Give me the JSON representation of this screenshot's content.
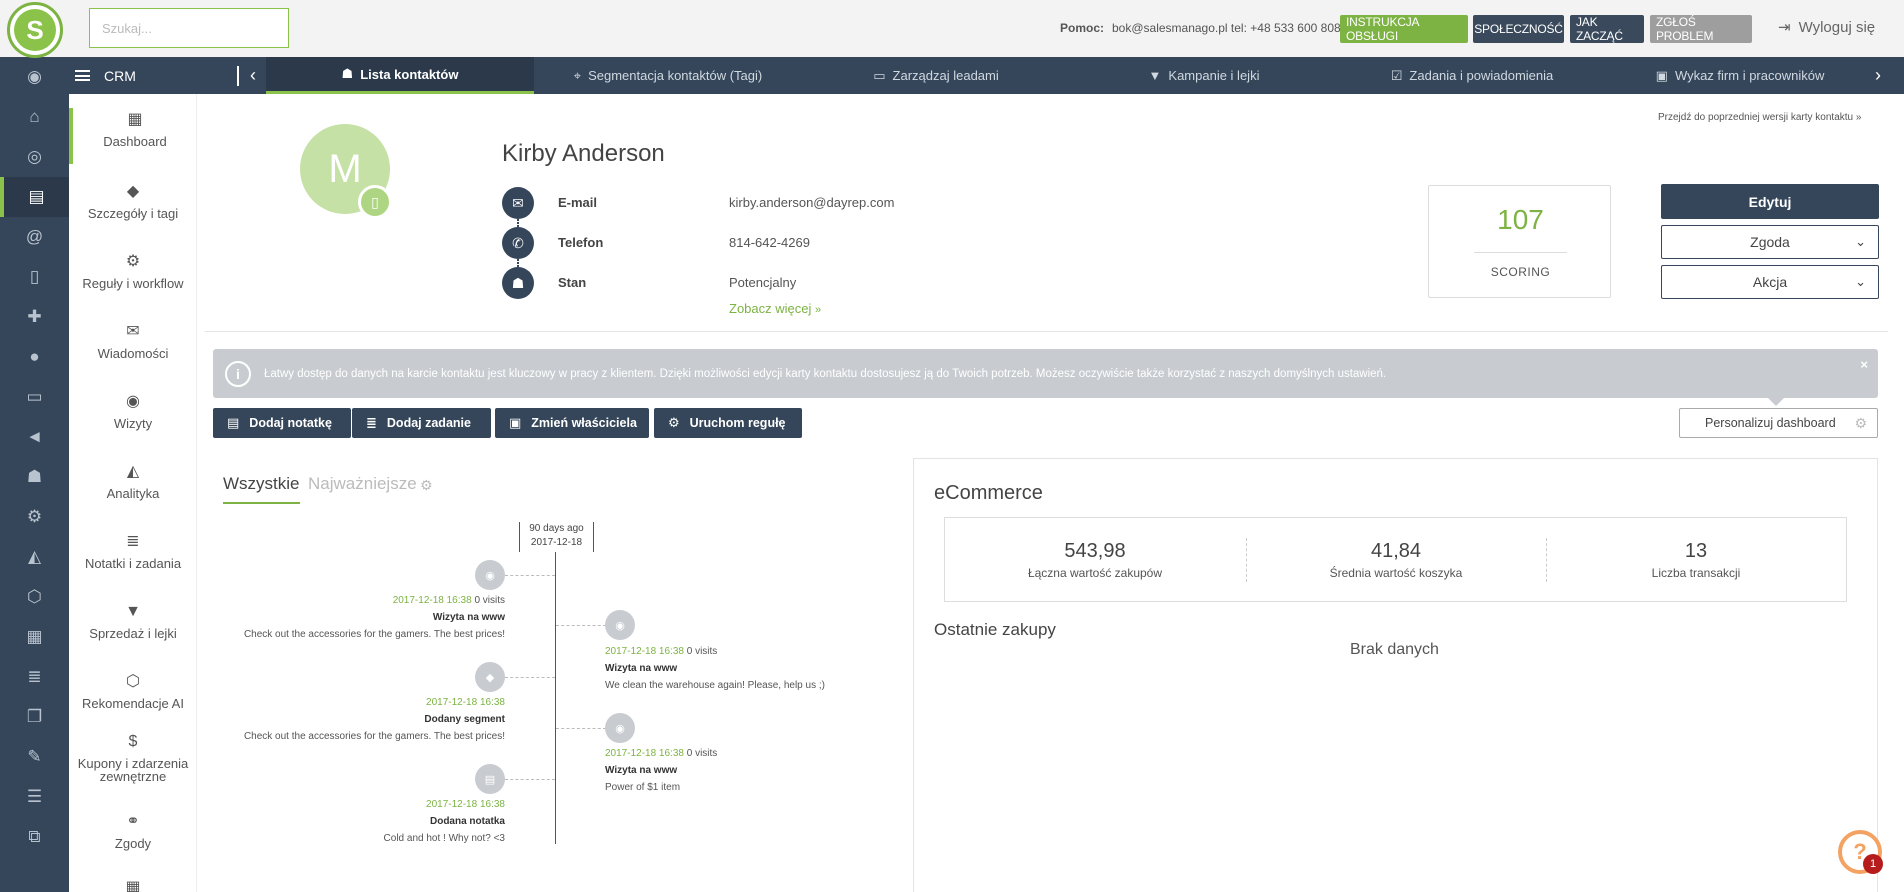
{
  "header": {
    "logo_letter": "S",
    "search_placeholder": "Szukaj...",
    "help_label": "Pomoc:",
    "help_contact": "bok@salesmanago.pl tel: +48 533 600 808",
    "btn_manual": "INSTRUKCJA OBSŁUGI",
    "btn_community": "SPOŁECZNOŚĆ",
    "btn_start": "JAK ZACZĄĆ",
    "btn_report": "ZGŁOŚ PROBLEM",
    "logout": "Wyloguj się"
  },
  "nav": {
    "crm": "CRM",
    "tabs": [
      {
        "label": "Lista kontaktów",
        "icon": "users-icon"
      },
      {
        "label": "Segmentacja kontaktów (Tagi)",
        "icon": "tags-icon"
      },
      {
        "label": "Zarządzaj leadami",
        "icon": "id-card-icon"
      },
      {
        "label": "Kampanie i lejki",
        "icon": "filter-icon"
      },
      {
        "label": "Zadania i powiadomienia",
        "icon": "check-square-icon"
      },
      {
        "label": "Wykaz firm i pracowników",
        "icon": "briefcase-icon"
      }
    ]
  },
  "sidebar": {
    "items": [
      {
        "label": "Dashboard",
        "icon": "grid-icon"
      },
      {
        "label": "Szczegóły i tagi",
        "icon": "tags-icon"
      },
      {
        "label": "Reguły i workflow",
        "icon": "cogs-icon"
      },
      {
        "label": "Wiadomości",
        "icon": "envelope-open-icon"
      },
      {
        "label": "Wizyty",
        "icon": "eye-icon"
      },
      {
        "label": "Analityka",
        "icon": "area-chart-icon"
      },
      {
        "label": "Notatki i zadania",
        "icon": "list-icon"
      },
      {
        "label": "Sprzedaż i lejki",
        "icon": "filter-icon"
      },
      {
        "label": "Rekomendacje AI",
        "icon": "ai-icon"
      },
      {
        "label": "Kupony i zdarzenia zewnętrzne",
        "icon": "dollar-icon"
      },
      {
        "label": "Zgody",
        "icon": "handshake-icon"
      }
    ]
  },
  "contact": {
    "prev_version_link": "Przejdź do poprzedniej wersji karty kontaktu",
    "avatar_letter": "M",
    "name": "Kirby Anderson",
    "email_label": "E-mail",
    "email": "kirby.anderson@dayrep.com",
    "phone_label": "Telefon",
    "phone": "814-642-4269",
    "status_label": "Stan",
    "status": "Potencjalny",
    "see_more": "Zobacz więcej",
    "score": "107",
    "score_label": "SCORING",
    "btn_edit": "Edytuj",
    "dd_consent": "Zgoda",
    "dd_action": "Akcja"
  },
  "info": {
    "text": "Łatwy dostęp do danych na karcie kontaktu jest kluczowy w pracy z klientem. Dzięki możliwości edycji karty kontaktu dostosujesz ją do Twoich potrzeb. Możesz oczywiście także korzystać z naszych domyślnych ustawień.",
    "close": "×"
  },
  "actions": {
    "add_note": "Dodaj notatkę",
    "add_task": "Dodaj zadanie",
    "change_owner": "Zmień właściciela",
    "run_rule": "Uruchom regułę",
    "personalize": "Personalizuj dashboard"
  },
  "timeline": {
    "tab_all": "Wszystkie",
    "tab_important": "Najważniejsze",
    "head_days": "90 days ago",
    "head_date": "2017-12-18",
    "events": [
      {
        "side": "left",
        "date": "2017-12-18 16:38",
        "extra": "0 visits",
        "title": "Wizyta na www",
        "desc": "Check out the accessories for the gamers. The best prices!",
        "icon": "eye-icon"
      },
      {
        "side": "right",
        "date": "2017-12-18 16:38",
        "extra": "0 visits",
        "title": "Wizyta na www",
        "desc": "We clean the warehouse again! Please, help us ;)",
        "icon": "eye-icon"
      },
      {
        "side": "left",
        "date": "2017-12-18 16:38",
        "extra": "",
        "title": "Dodany segment",
        "desc": "Check out the accessories for the gamers. The best prices!",
        "icon": "tag-icon"
      },
      {
        "side": "right",
        "date": "2017-12-18 16:38",
        "extra": "0 visits",
        "title": "Wizyta na www",
        "desc": "Power of $1 item",
        "icon": "eye-icon"
      },
      {
        "side": "left",
        "date": "2017-12-18 16:38",
        "extra": "",
        "title": "Dodana notatka",
        "desc": "Cold and hot ! Why not? <3",
        "icon": "note-icon"
      }
    ]
  },
  "ecommerce": {
    "title": "eCommerce",
    "stats": [
      {
        "value": "543,98",
        "label": "Łączna wartość zakupów"
      },
      {
        "value": "41,84",
        "label": "Średnia wartość koszyka"
      },
      {
        "value": "13",
        "label": "Liczba transakcji"
      }
    ],
    "recent_title": "Ostatnie zakupy",
    "no_data": "Brak danych"
  },
  "help_widget": {
    "symbol": "?",
    "badge": "1"
  }
}
